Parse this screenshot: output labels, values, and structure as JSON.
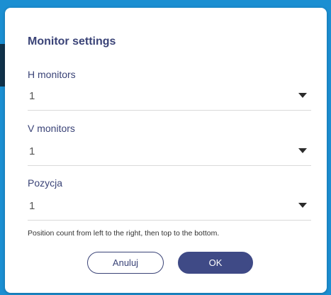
{
  "dialog": {
    "title": "Monitor settings",
    "fields": [
      {
        "label": "H monitors",
        "value": "1"
      },
      {
        "label": "V monitors",
        "value": "1"
      },
      {
        "label": "Pozycja",
        "value": "1"
      }
    ],
    "hint": "Position count from left to the right, then top to the bottom.",
    "cancel_label": "Anuluj",
    "ok_label": "OK"
  },
  "colors": {
    "accent": "#3f4a86",
    "title_text": "#3a4377",
    "backdrop": "#1b8fd2"
  }
}
